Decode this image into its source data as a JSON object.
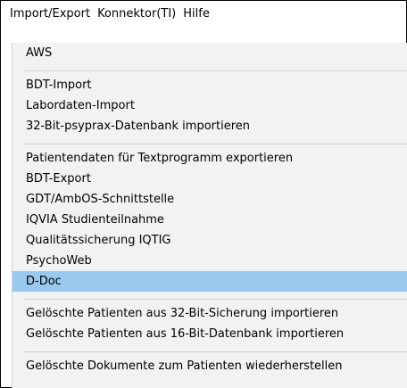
{
  "menubar": {
    "items": [
      {
        "label": "Import/Export"
      },
      {
        "label": "Konnektor(TI)"
      },
      {
        "label": "Hilfe"
      }
    ]
  },
  "dropdown": {
    "items": [
      {
        "label": "AWS"
      },
      {
        "label": "BDT-Import"
      },
      {
        "label": "Labordaten-Import"
      },
      {
        "label": "32-Bit-psyprax-Datenbank importieren"
      },
      {
        "label": "Patientendaten für Textprogramm exportieren"
      },
      {
        "label": "BDT-Export"
      },
      {
        "label": "GDT/AmbOS-Schnittstelle"
      },
      {
        "label": "IQVIA Studienteilnahme"
      },
      {
        "label": "Qualitätssicherung IQTIG"
      },
      {
        "label": "PsychoWeb"
      },
      {
        "label": "D-Doc",
        "highlighted": true
      },
      {
        "label": "Gelöschte Patienten aus 32-Bit-Sicherung importieren"
      },
      {
        "label": "Gelöschte Patienten aus 16-Bit-Datenbank importieren"
      },
      {
        "label": "Gelöschte Dokumente zum Patienten wiederherstellen"
      }
    ]
  },
  "colors": {
    "highlight": "#99c9ef",
    "menu_background": "#f2f2f2",
    "separator": "#d0d0d0"
  }
}
